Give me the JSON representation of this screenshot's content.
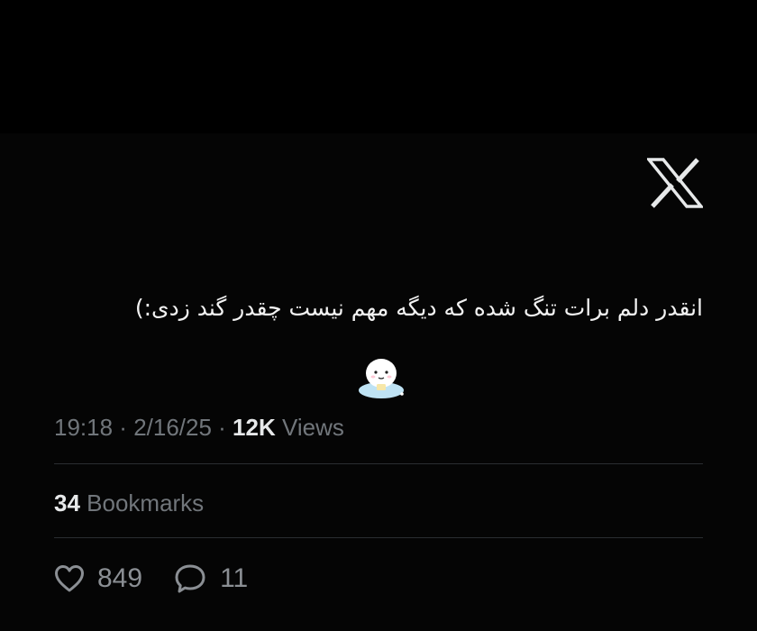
{
  "tweet": {
    "text": "انقدر دلم برات تنگ شده که دیگه مهم نیست چقدر گند زدی:)",
    "time": "19:18",
    "separator": " · ",
    "date": "2/16/25",
    "views_count": "12K",
    "views_label": " Views"
  },
  "stats": {
    "bookmarks_count": "34",
    "bookmarks_label": " Bookmarks"
  },
  "actions": {
    "likes": "849",
    "replies": "11"
  },
  "icons": {
    "logo": "x-logo-icon",
    "like": "heart-icon",
    "reply": "reply-bubble-icon",
    "sticker": "cute-character-sticker"
  },
  "colors": {
    "background": "#000000",
    "text": "#e7e9ea",
    "muted": "#71767b"
  }
}
